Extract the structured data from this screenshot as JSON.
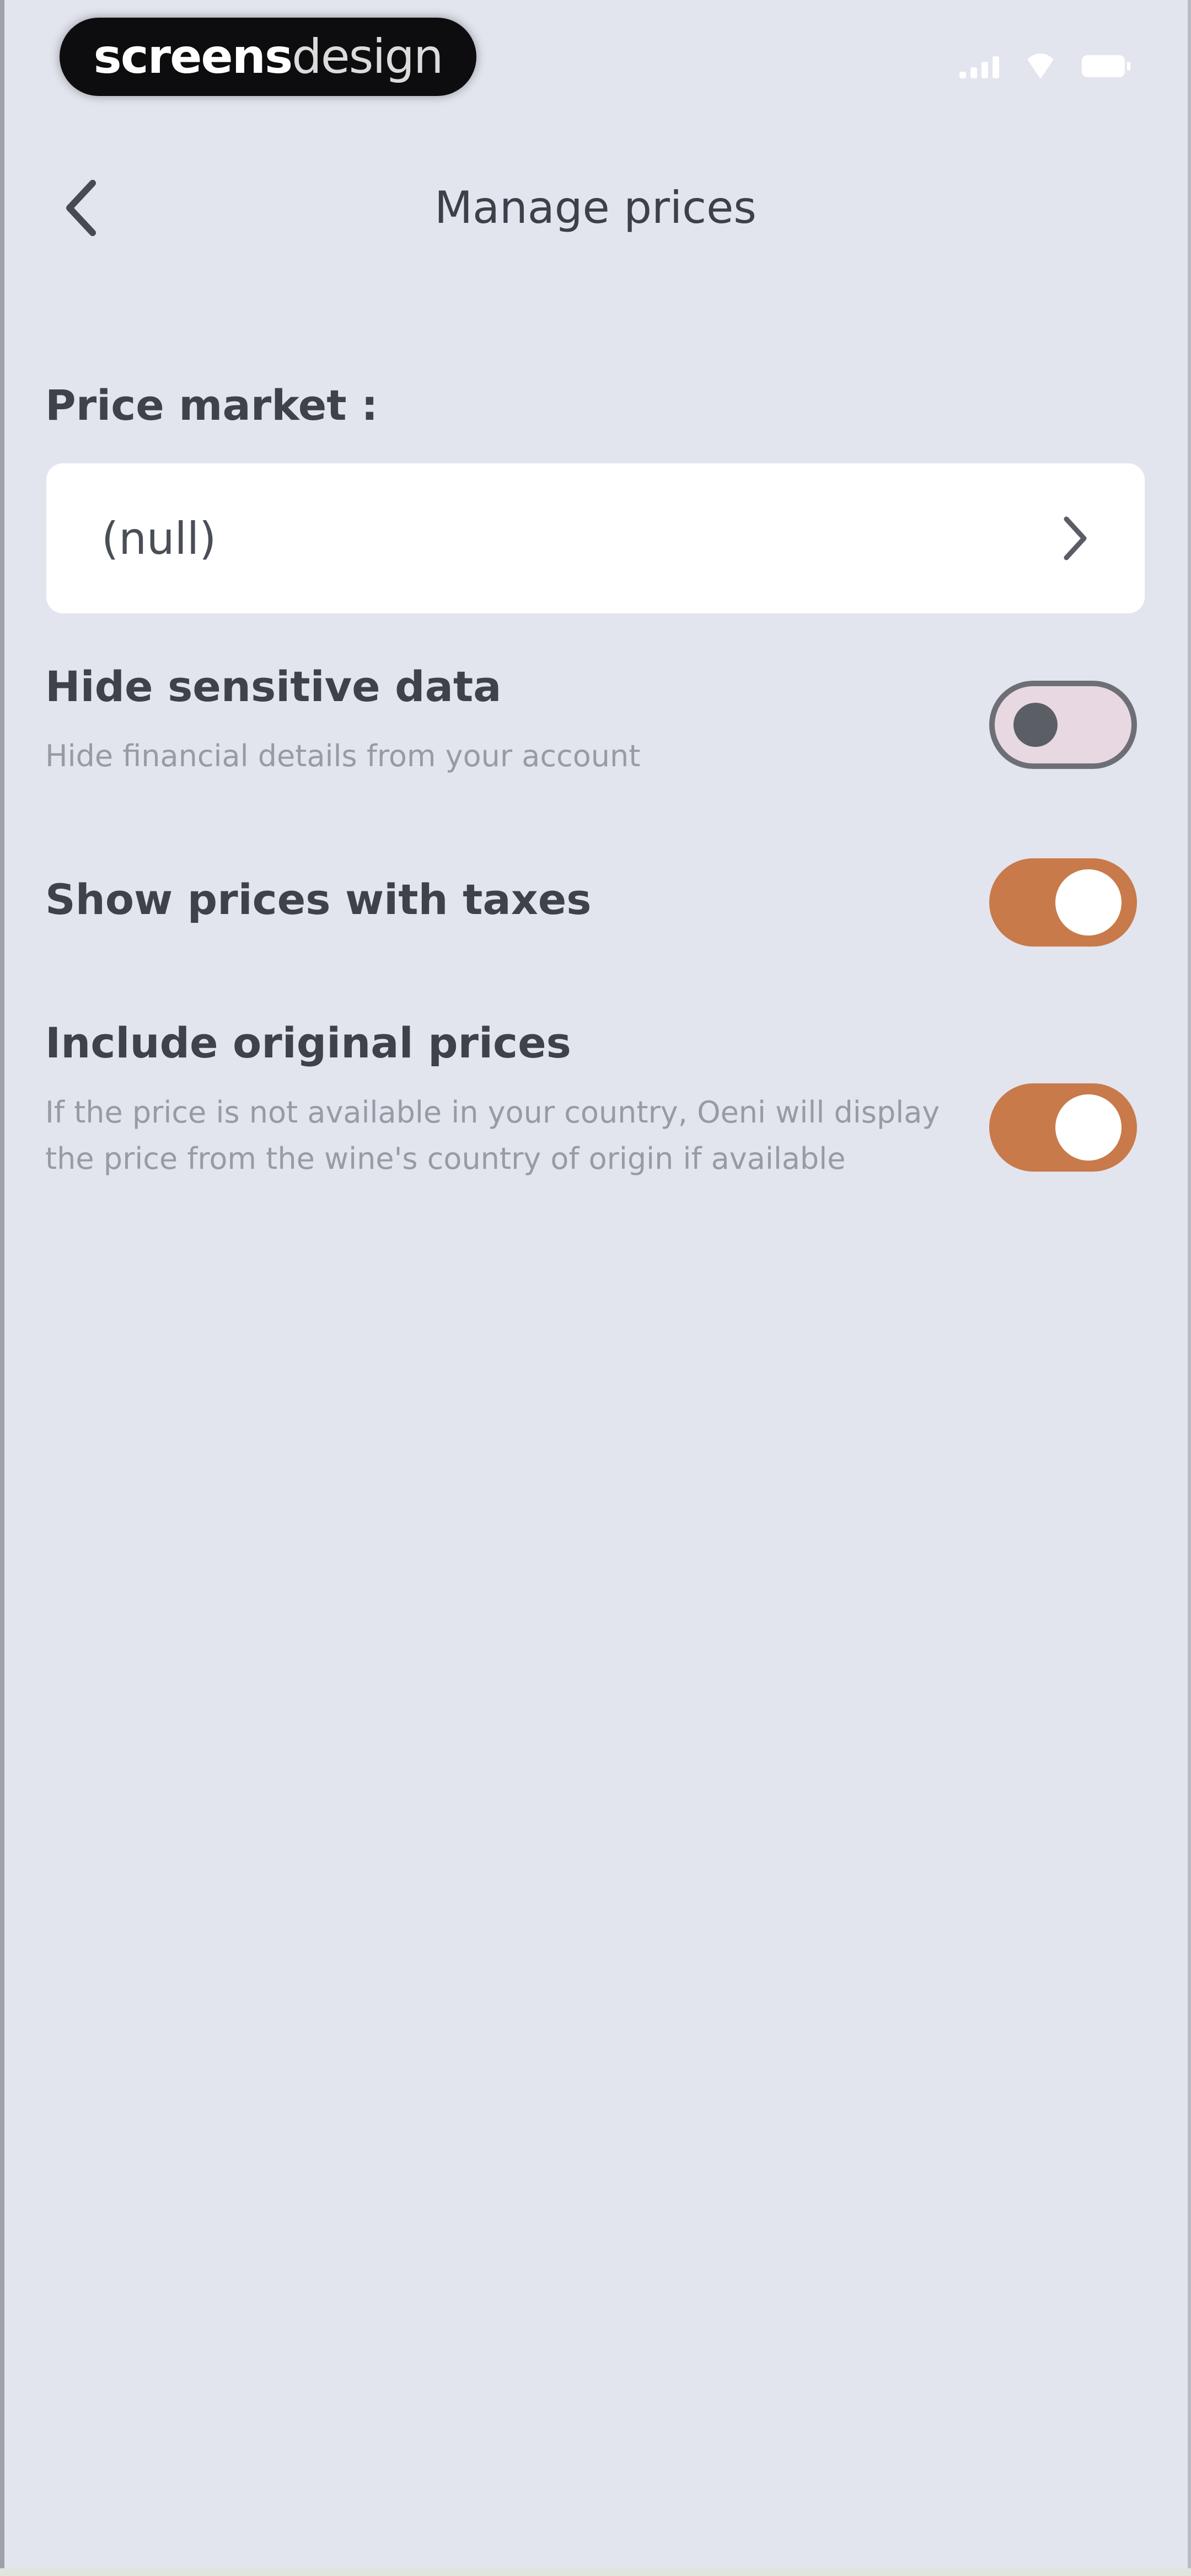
{
  "status_bar": {
    "brand_part1": "screens",
    "brand_part2": "design"
  },
  "header": {
    "title": "Manage prices"
  },
  "price_market": {
    "label": "Price market :",
    "value": "(null)"
  },
  "settings": [
    {
      "title": "Hide sensitive data",
      "description": "Hide financial details from your account",
      "enabled": false
    },
    {
      "title": "Show prices with taxes",
      "description": "",
      "enabled": true
    },
    {
      "title": "Include original prices",
      "description": "If the price is not available in your country, Oeni will display the price from the wine's country of origin if available",
      "enabled": true
    }
  ],
  "colors": {
    "background": "#e2e5ee",
    "toggle_on": "#c87a4a",
    "toggle_off": "#e8d8e2",
    "card": "#ffffff"
  }
}
